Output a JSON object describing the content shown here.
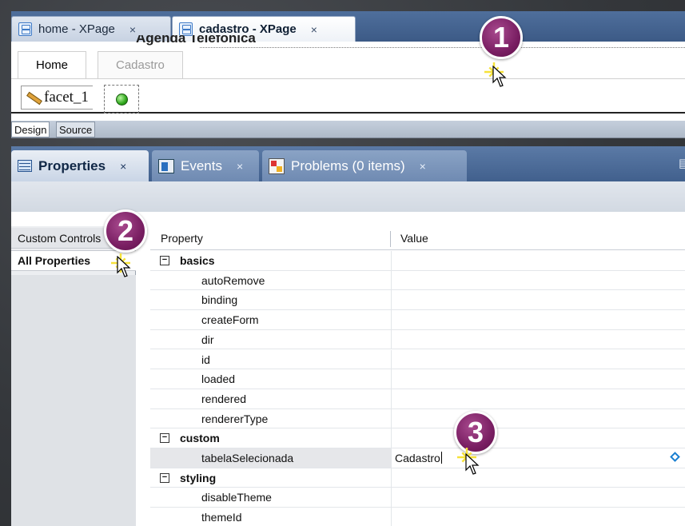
{
  "editor": {
    "tabs": [
      {
        "label": "home - XPage",
        "active": false
      },
      {
        "label": "cadastro - XPage",
        "active": true
      }
    ],
    "close_glyph": "×",
    "clipped_heading": "Agenda Telefonica",
    "custom_control_tabs": [
      "Home",
      "Cadastro"
    ],
    "facet_label": "facet_1"
  },
  "design_source": {
    "design": "Design",
    "source": "Source"
  },
  "views": {
    "tabs": [
      {
        "label": "Properties",
        "icon": "properties-icon",
        "active": true
      },
      {
        "label": "Events",
        "icon": "events-icon",
        "active": false
      },
      {
        "label": "Problems (0 items)",
        "icon": "problems-icon",
        "active": false
      }
    ]
  },
  "properties": {
    "nav": [
      "Custom Controls",
      "All Properties"
    ],
    "columns": {
      "property": "Property",
      "value": "Value"
    },
    "rows": [
      {
        "label": "basics",
        "group": true
      },
      {
        "label": "autoRemove"
      },
      {
        "label": "binding"
      },
      {
        "label": "createForm"
      },
      {
        "label": "dir"
      },
      {
        "label": "id"
      },
      {
        "label": "loaded"
      },
      {
        "label": "rendered"
      },
      {
        "label": "rendererType"
      },
      {
        "label": "custom",
        "group": true
      },
      {
        "label": "tabelaSelecionada",
        "value": "Cadastro",
        "selected": true
      },
      {
        "label": "styling",
        "group": true
      },
      {
        "label": "disableTheme"
      },
      {
        "label": "themeId"
      }
    ],
    "collapse_glyph": "−"
  },
  "callouts": [
    "1",
    "2",
    "3"
  ],
  "colors": {
    "callout": "#7a1f63",
    "tab_bar": "#4f6f9c",
    "diamond": "#1a7fd1",
    "sparkle": "#f6e23a"
  }
}
